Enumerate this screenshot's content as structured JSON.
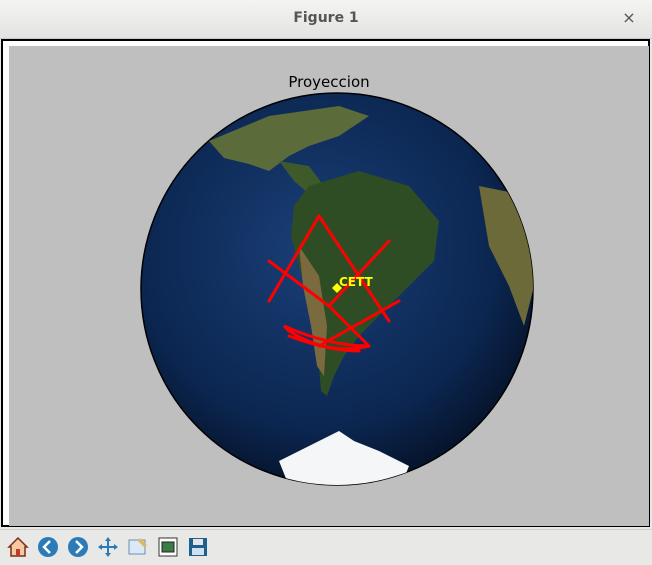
{
  "window": {
    "title": "Figure 1",
    "close_glyph": "×"
  },
  "plot": {
    "title": "Proyeccion",
    "station_label": "CETT"
  },
  "toolbar": {
    "buttons": [
      {
        "name": "home-button",
        "icon": "home-icon"
      },
      {
        "name": "back-button",
        "icon": "arrow-left-icon"
      },
      {
        "name": "forward-button",
        "icon": "arrow-right-icon"
      },
      {
        "name": "pan-button",
        "icon": "move-arrows-icon"
      },
      {
        "name": "zoom-button",
        "icon": "zoom-rect-icon"
      },
      {
        "name": "subplots-button",
        "icon": "subplots-icon"
      },
      {
        "name": "save-button",
        "icon": "floppy-disk-icon"
      }
    ]
  },
  "colors": {
    "track": "#ff0000",
    "station": "#ffff00",
    "ocean": "#0b2a5a",
    "land": "#2f4d24",
    "ice": "#ffffff"
  }
}
